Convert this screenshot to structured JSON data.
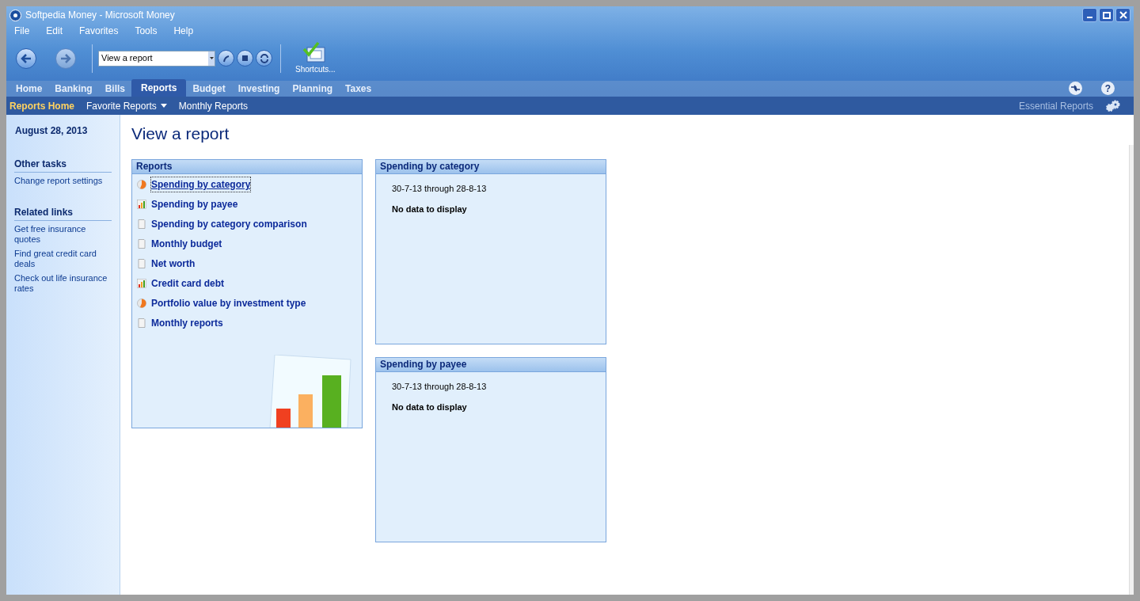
{
  "window": {
    "title": "Softpedia Money - Microsoft Money"
  },
  "menu": [
    "File",
    "Edit",
    "Favorites",
    "Tools",
    "Help"
  ],
  "toolbar": {
    "address": "View a report",
    "shortcuts_label": "Shortcuts..."
  },
  "help_glyph": "?",
  "tabs": [
    {
      "label": "Home",
      "selected": false
    },
    {
      "label": "Banking",
      "selected": false
    },
    {
      "label": "Bills",
      "selected": false
    },
    {
      "label": "Reports",
      "selected": true
    },
    {
      "label": "Budget",
      "selected": false
    },
    {
      "label": "Investing",
      "selected": false
    },
    {
      "label": "Planning",
      "selected": false
    },
    {
      "label": "Taxes",
      "selected": false
    }
  ],
  "subnav": {
    "items": [
      {
        "label": "Reports Home",
        "selected": true,
        "dropdown": false
      },
      {
        "label": "Favorite Reports",
        "selected": false,
        "dropdown": true
      },
      {
        "label": "Monthly Reports",
        "selected": false,
        "dropdown": false
      }
    ],
    "right_link": "Essential Reports"
  },
  "sidebar": {
    "date": "August 28, 2013",
    "sections": [
      {
        "title": "Other tasks",
        "links": [
          "Change report settings"
        ]
      },
      {
        "title": "Related links",
        "links": [
          "Get free insurance quotes",
          "Find great credit card deals",
          "Check out life insurance rates"
        ]
      }
    ]
  },
  "page_title": "View a report",
  "reports_panel": {
    "title": "Reports",
    "items": [
      {
        "label": "Spending by category",
        "kind": "pie",
        "focused": true
      },
      {
        "label": "Spending by payee",
        "kind": "bar",
        "focused": false
      },
      {
        "label": "Spending by category comparison",
        "kind": "doc",
        "focused": false
      },
      {
        "label": "Monthly budget",
        "kind": "doc",
        "focused": false
      },
      {
        "label": "Net worth",
        "kind": "doc",
        "focused": false
      },
      {
        "label": "Credit card debt",
        "kind": "bar",
        "focused": false
      },
      {
        "label": "Portfolio value by investment type",
        "kind": "pie",
        "focused": false
      },
      {
        "label": "Monthly reports",
        "kind": "doc",
        "focused": false
      }
    ]
  },
  "preview_panels": [
    {
      "title": "Spending by category",
      "range": "30-7-13 through 28-8-13",
      "message": "No data to display"
    },
    {
      "title": "Spending by payee",
      "range": "30-7-13 through 28-8-13",
      "message": "No data to display"
    }
  ]
}
